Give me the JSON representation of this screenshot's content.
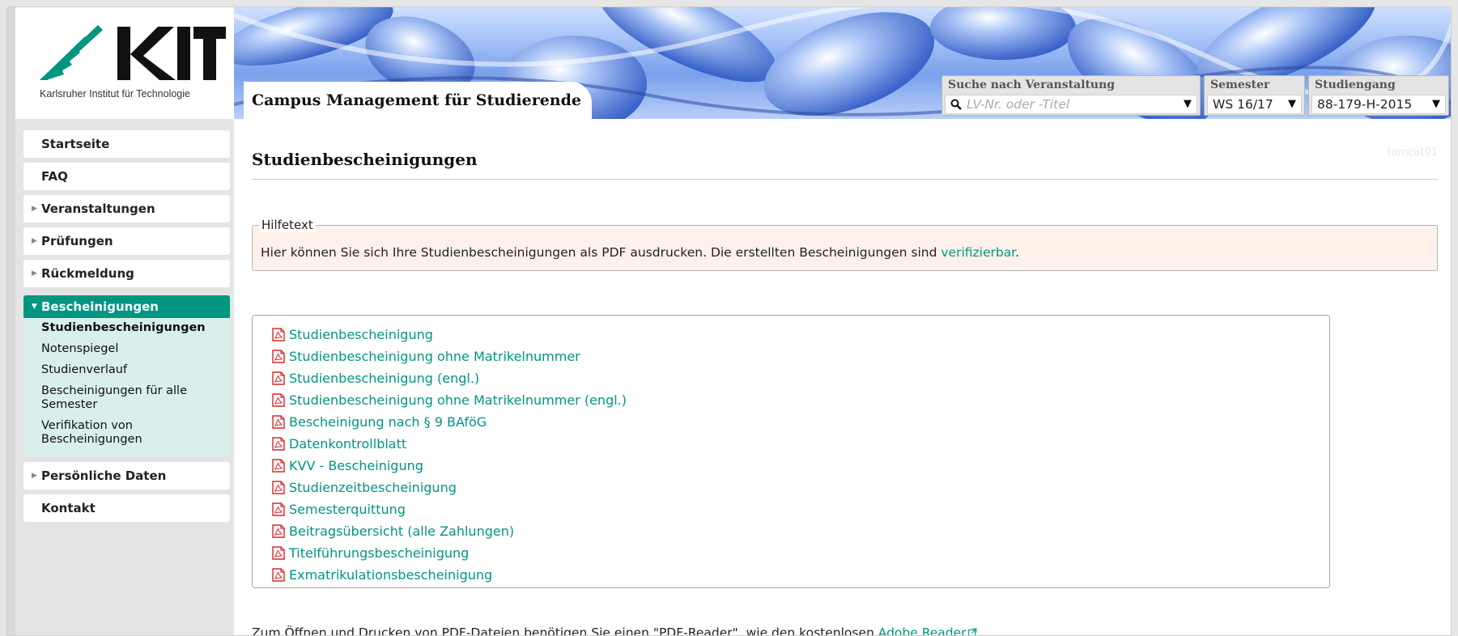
{
  "header": {
    "logo_caption": "Karlsruher Institut für Technologie",
    "app_title": "Campus Management für Studierende",
    "search": {
      "label": "Suche nach Veranstaltung",
      "placeholder": "LV-Nr. oder -Titel"
    },
    "semester": {
      "label": "Semester",
      "value": "WS 16/17"
    },
    "program": {
      "label": "Studiengang",
      "value": "88-179-H-2015"
    }
  },
  "sidebar": {
    "items": [
      {
        "label": "Startseite"
      },
      {
        "label": "FAQ"
      },
      {
        "label": "Veranstaltungen"
      },
      {
        "label": "Prüfungen"
      },
      {
        "label": "Rückmeldung"
      },
      {
        "label": "Bescheinigungen"
      },
      {
        "label": "Persönliche Daten"
      },
      {
        "label": "Kontakt"
      }
    ],
    "submenu": [
      "Studienbescheinigungen",
      "Notenspiegel",
      "Studienverlauf",
      "Bescheinigungen für alle Semester",
      "Verifikation von Bescheinigungen"
    ]
  },
  "main": {
    "title": "Studienbescheinigungen",
    "server_tag": "tomcat01",
    "help": {
      "legend": "Hilfetext",
      "text_before": "Hier können Sie sich Ihre Studienbescheinigungen als PDF ausdrucken. Die erstellten Bescheinigungen sind ",
      "link": "verifizierbar",
      "text_after": "."
    },
    "documents": [
      "Studienbescheinigung",
      "Studienbescheinigung ohne Matrikelnummer",
      "Studienbescheinigung (engl.)",
      "Studienbescheinigung ohne Matrikelnummer (engl.)",
      "Bescheinigung nach § 9 BAföG",
      "Datenkontrollblatt",
      "KVV - Bescheinigung",
      "Studienzeitbescheinigung",
      "Semesterquittung",
      "Beitragsübersicht (alle Zahlungen)",
      "Titelführungsbescheinigung",
      "Exmatrikulationsbescheinigung"
    ],
    "footer": {
      "text": "Zum Öffnen und Drucken von PDF-Dateien benötigen Sie einen \"PDF-Reader\", wie den kostenlosen ",
      "link": "Adobe Reader",
      "text_after": "."
    }
  },
  "colors": {
    "accent": "#009682",
    "help_bg": "#fdf1e9",
    "pdf_red": "#d9262c"
  }
}
